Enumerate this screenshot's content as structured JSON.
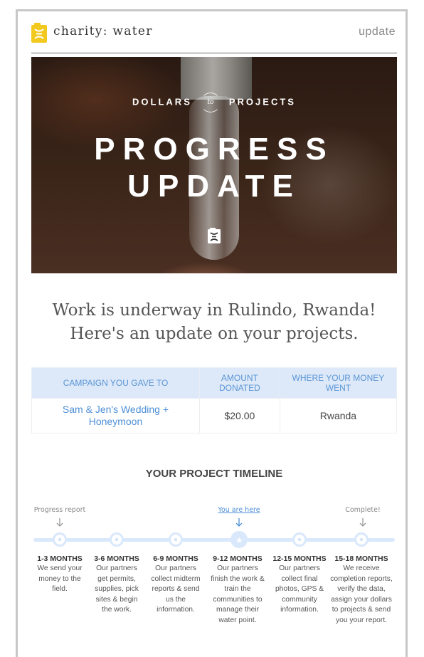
{
  "header": {
    "brand": "charity: water",
    "right_label": "update",
    "logo_color": "#F2C91E"
  },
  "hero": {
    "kicker_left": "DOLLARS",
    "kicker_mid": "to",
    "kicker_right": "PROJECTS",
    "title_line1": "PROGRESS",
    "title_line2": "UPDATE"
  },
  "headline": {
    "line1": "Work is underway in Rulindo, Rwanda!",
    "line2": "Here's an update on your projects."
  },
  "donation_table": {
    "headers": [
      "CAMPAIGN YOU GAVE TO",
      "AMOUNT DONATED",
      "WHERE YOUR MONEY WENT"
    ],
    "rows": [
      {
        "campaign": "Sam & Jen's Wedding + Honeymoon",
        "amount": "$20.00",
        "location": "Rwanda"
      }
    ]
  },
  "timeline": {
    "title": "YOUR PROJECT TIMELINE",
    "markers": {
      "progress_report": "Progress report",
      "you_are_here": "You are here",
      "complete": "Complete!"
    },
    "current_step_index": 3,
    "steps": [
      {
        "title": "1-3 MONTHS",
        "description": "We send your money to the field."
      },
      {
        "title": "3-6 MONTHS",
        "description": "Our partners get permits, supplies, pick sites & begin the work."
      },
      {
        "title": "6-9 MONTHS",
        "description": "Our partners collect midterm reports & send us the information."
      },
      {
        "title": "9-12 MONTHS",
        "description": "Our partners finish the work & train the communities to manage their water point."
      },
      {
        "title": "12-15 MONTHS",
        "description": "Our partners collect final photos, GPS & community information."
      },
      {
        "title": "15-18 MONTHS",
        "description": "We receive completion reports, verify the data, assign your dollars to projects & send you your report."
      }
    ]
  }
}
